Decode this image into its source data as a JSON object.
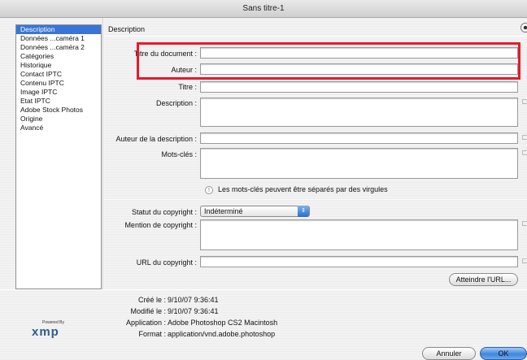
{
  "window": {
    "title": "Sans titre-1"
  },
  "sidebar": {
    "items": [
      {
        "label": "Description",
        "selected": true
      },
      {
        "label": "Données ...caméra 1",
        "selected": false
      },
      {
        "label": "Données ...caméra 2",
        "selected": false
      },
      {
        "label": "Catégories",
        "selected": false
      },
      {
        "label": "Historique",
        "selected": false
      },
      {
        "label": "Contact IPTC",
        "selected": false
      },
      {
        "label": "Contenu IPTC",
        "selected": false
      },
      {
        "label": "Image IPTC",
        "selected": false
      },
      {
        "label": "Etat IPTC",
        "selected": false
      },
      {
        "label": "Adobe Stock Photos",
        "selected": false
      },
      {
        "label": "Origine",
        "selected": false
      },
      {
        "label": "Avancé",
        "selected": false
      }
    ]
  },
  "main": {
    "section_title": "Description",
    "fields": {
      "document_title": {
        "label": "Titre du document :",
        "value": ""
      },
      "author": {
        "label": "Auteur :",
        "value": ""
      },
      "title": {
        "label": "Titre :",
        "value": ""
      },
      "description": {
        "label": "Description :",
        "value": ""
      },
      "description_author": {
        "label": "Auteur de la description :",
        "value": ""
      },
      "keywords": {
        "label": "Mots-clés :",
        "value": ""
      }
    },
    "keywords_hint": "Les mots-clés peuvent être séparés par des virgules",
    "copyright": {
      "status_label": "Statut du copyright :",
      "status_value": "Indéterminé",
      "notice_label": "Mention de copyright :",
      "url_label": "URL du copyright :",
      "goto_url_button": "Atteindre l'URL..."
    },
    "info": {
      "created": {
        "label": "Créé le :",
        "value": "9/10/07 9:36:41"
      },
      "modified": {
        "label": "Modifié le :",
        "value": "9/10/07 9:36:41"
      },
      "application": {
        "label": "Application :",
        "value": "Adobe Photoshop CS2 Macintosh"
      },
      "format": {
        "label": "Format :",
        "value": "application/vnd.adobe.photoshop"
      }
    }
  },
  "logo": {
    "powered_by": "Powered By",
    "name": "xmp"
  },
  "buttons": {
    "cancel": "Annuler",
    "ok": "OK"
  },
  "colors": {
    "selection": "#3875d7",
    "highlight_box": "#e8192c",
    "default_button": "#3d86dd"
  }
}
